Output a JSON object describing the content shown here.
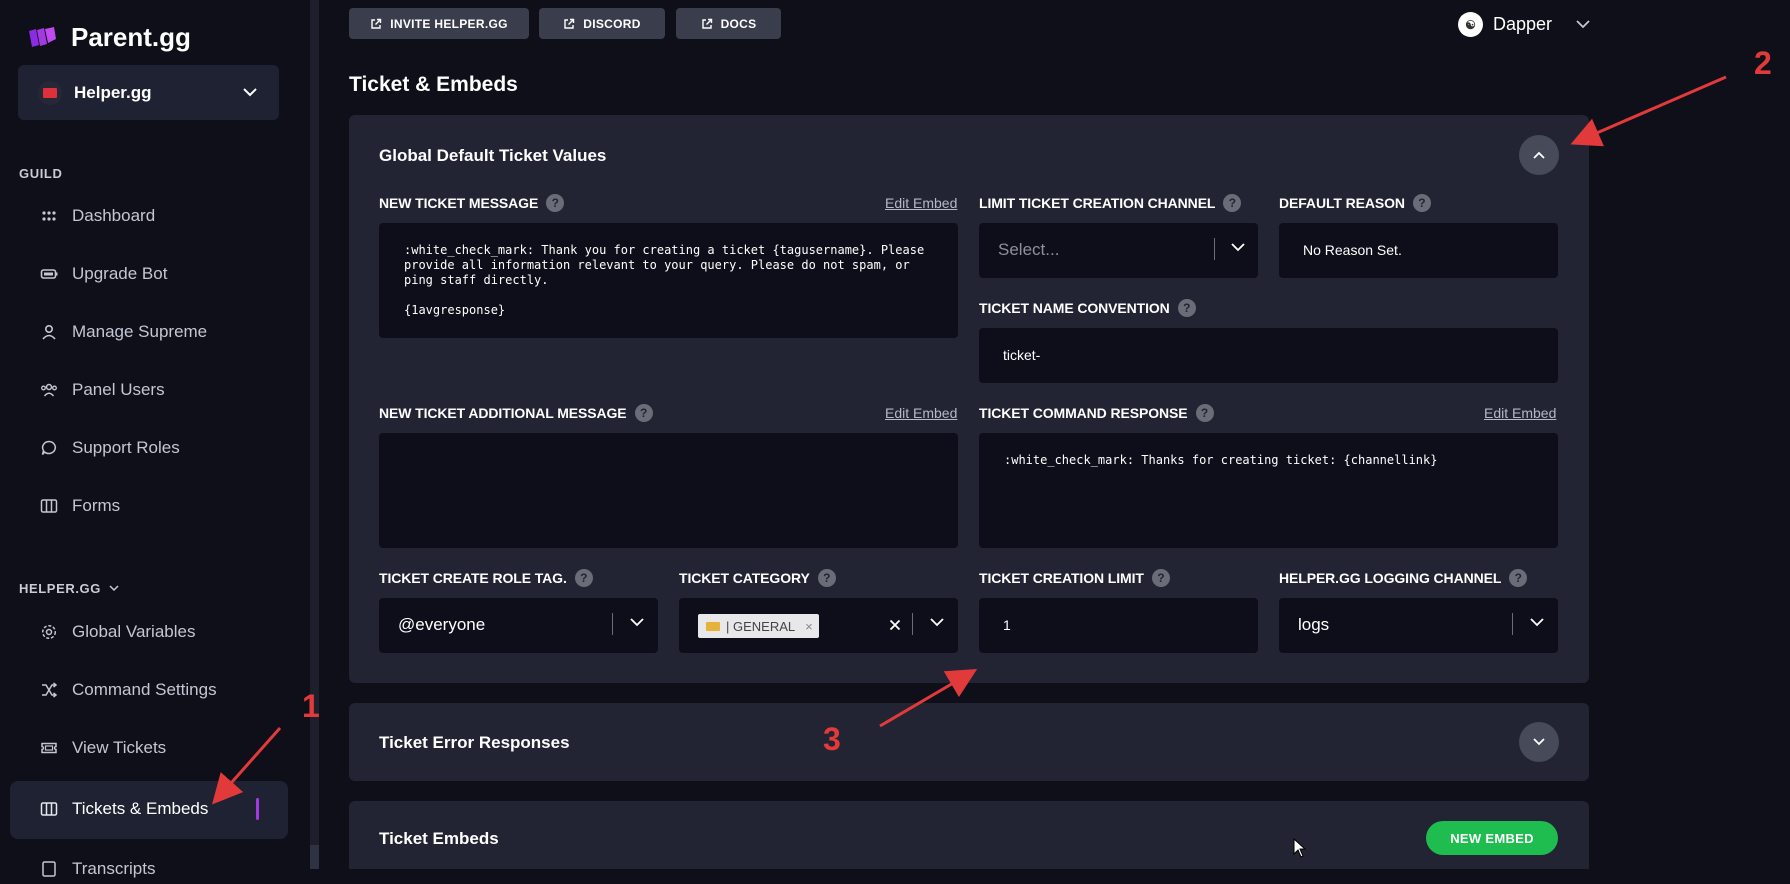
{
  "brand": {
    "name": "Parent.gg"
  },
  "guild_selector": {
    "name": "Helper.gg"
  },
  "sidebar": {
    "section_guild": "GUILD",
    "guild_items": [
      {
        "label": "Dashboard",
        "icon": "grid-icon"
      },
      {
        "label": "Upgrade Bot",
        "icon": "battery-icon"
      },
      {
        "label": "Manage Supreme",
        "icon": "user-icon"
      },
      {
        "label": "Panel Users",
        "icon": "users-icon"
      },
      {
        "label": "Support Roles",
        "icon": "chat-icon"
      },
      {
        "label": "Forms",
        "icon": "columns-icon"
      }
    ],
    "section_helper": "HELPER.GG",
    "helper_items": [
      {
        "label": "Global Variables",
        "icon": "gear-icon"
      },
      {
        "label": "Command Settings",
        "icon": "shuffle-icon"
      },
      {
        "label": "View Tickets",
        "icon": "ticket-icon"
      },
      {
        "label": "Tickets & Embeds",
        "icon": "columns-icon",
        "active": true
      },
      {
        "label": "Transcripts",
        "icon": "file-icon"
      }
    ]
  },
  "topbar": {
    "invite_label": "INVITE HELPER.GG",
    "discord_label": "DISCORD",
    "docs_label": "DOCS",
    "user_name": "Dapper"
  },
  "page_title": "Ticket & Embeds",
  "global_defaults": {
    "title": "Global Default Ticket Values",
    "new_ticket_message": {
      "label": "NEW TICKET MESSAGE",
      "edit_link": "Edit Embed",
      "value": ":white_check_mark: Thank you for creating a ticket {tagusername}. Please\nprovide all information relevant to your query. Please do not spam, or\nping staff directly.\n\n{1avgresponse}"
    },
    "limit_channel": {
      "label": "LIMIT TICKET CREATION CHANNEL",
      "placeholder": "Select..."
    },
    "default_reason": {
      "label": "DEFAULT REASON",
      "value": "No Reason Set."
    },
    "name_convention": {
      "label": "TICKET NAME CONVENTION",
      "value": "ticket-"
    },
    "additional_message": {
      "label": "NEW TICKET ADDITIONAL MESSAGE",
      "edit_link": "Edit Embed",
      "value": ""
    },
    "command_response": {
      "label": "TICKET COMMAND RESPONSE",
      "edit_link": "Edit Embed",
      "value": ":white_check_mark: Thanks for creating ticket: {channellink}"
    },
    "role_tag": {
      "label": "TICKET CREATE ROLE TAG.",
      "value": "@everyone"
    },
    "category": {
      "label": "TICKET CATEGORY",
      "tag": "| GENERAL"
    },
    "creation_limit": {
      "label": "TICKET CREATION LIMIT",
      "value": "1"
    },
    "logging_channel": {
      "label": "HELPER.GG LOGGING CHANNEL",
      "value": "logs"
    }
  },
  "error_responses": {
    "title": "Ticket Error Responses"
  },
  "ticket_embeds": {
    "title": "Ticket Embeds",
    "new_embed_label": "NEW EMBED"
  },
  "annotations": {
    "one": "1",
    "two": "2",
    "three": "3"
  },
  "colors": {
    "accent": "#a33ae0",
    "green": "#1fbd4f",
    "annotation_red": "#e23a3a"
  }
}
